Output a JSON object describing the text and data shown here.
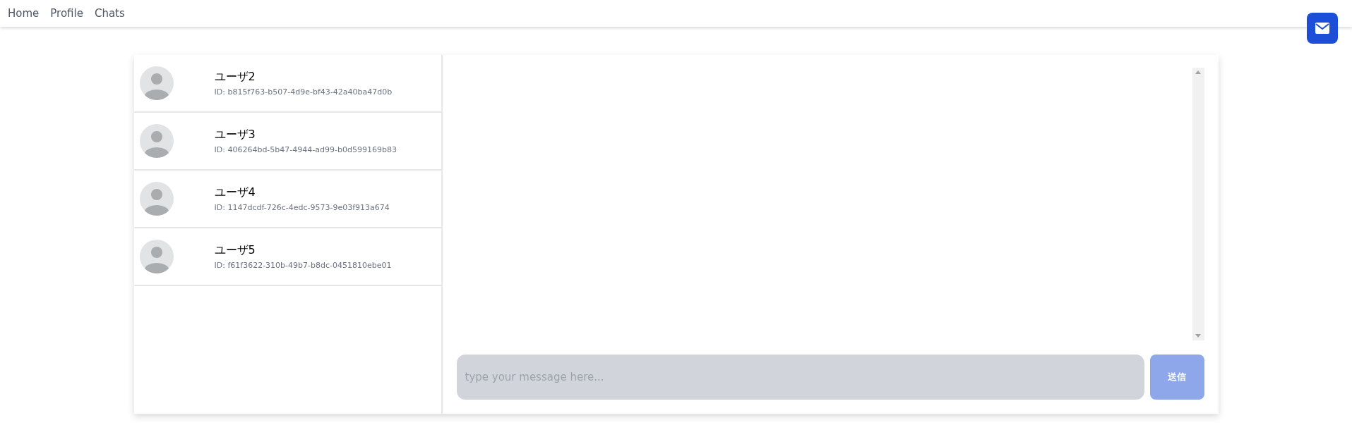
{
  "nav": [
    {
      "label": "Home"
    },
    {
      "label": "Profile"
    },
    {
      "label": "Chats"
    }
  ],
  "users": [
    {
      "name": "ユーザ2",
      "id": "ID: b815f763-b507-4d9e-bf43-42a40ba47d0b"
    },
    {
      "name": "ユーザ3",
      "id": "ID: 406264bd-5b47-4944-ad99-b0d599169b83"
    },
    {
      "name": "ユーザ4",
      "id": "ID: 1147dcdf-726c-4edc-9573-9e03f913a674"
    },
    {
      "name": "ユーザ5",
      "id": "ID: f61f3622-310b-49b7-b8dc-0451810ebe01"
    }
  ],
  "composer": {
    "placeholder": "type your message here...",
    "send_label": "送信",
    "send_disabled": true
  }
}
